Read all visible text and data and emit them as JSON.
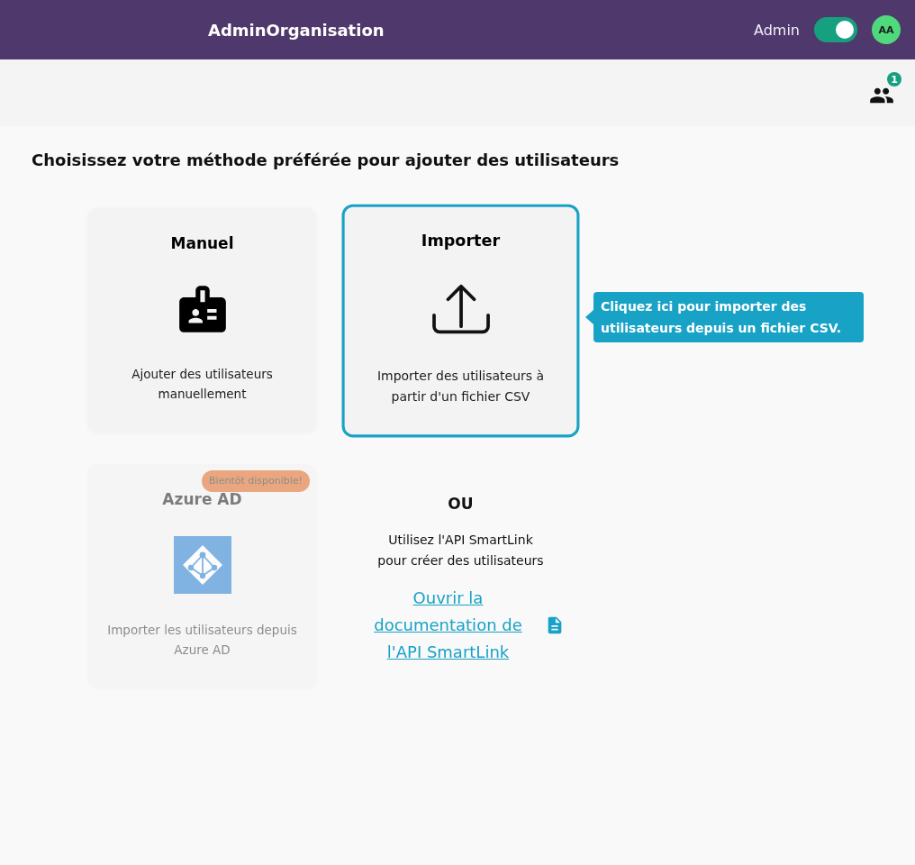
{
  "header": {
    "title": "AdminOrganisation",
    "role_label": "Admin",
    "admin_toggle": {
      "on": true
    },
    "avatar": "AA"
  },
  "toolbar": {
    "users_badge": "1"
  },
  "heading": "Choisissez votre méthode préférée pour ajouter des utilisateurs",
  "methods": [
    {
      "kind": "manual",
      "title": "Manuel",
      "description": "Ajouter des utilisateurs manuellement",
      "selected": false,
      "disabled": false
    },
    {
      "kind": "import",
      "title": "Importer",
      "description": "Importer des utilisateurs à partir d'un fichier CSV",
      "selected": true,
      "disabled": false,
      "tooltip": "Cliquez ici pour importer des utilisateurs depuis un fichier CSV."
    },
    {
      "kind": "azure",
      "title": "Azure AD",
      "description": "Importer les utilisateurs depuis Azure AD",
      "selected": false,
      "disabled": true,
      "badge": "Bientôt disponible!"
    }
  ],
  "api_option": {
    "separator": "OU",
    "text": "Utilisez l'API SmartLink pour créer des utilisateurs",
    "link": "Ouvrir la documentation de l'API SmartLink"
  }
}
